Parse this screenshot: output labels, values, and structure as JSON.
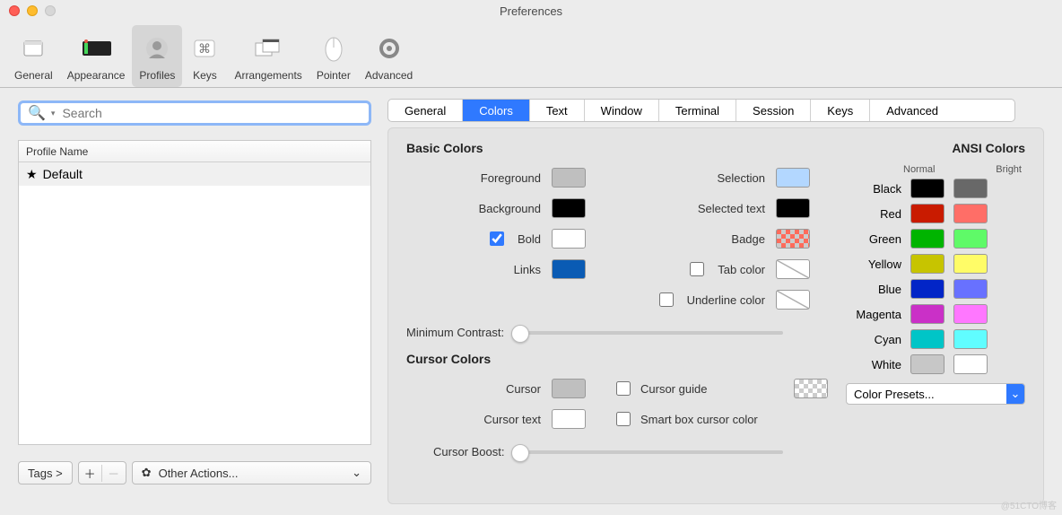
{
  "window": {
    "title": "Preferences"
  },
  "toolbar": {
    "items": [
      "General",
      "Appearance",
      "Profiles",
      "Keys",
      "Arrangements",
      "Pointer",
      "Advanced"
    ],
    "selected": "Profiles"
  },
  "search": {
    "placeholder": "Search"
  },
  "profiles": {
    "header": "Profile Name",
    "rows": [
      {
        "name": "Default",
        "star": true
      }
    ]
  },
  "bottom": {
    "tags": "Tags >",
    "actions": "Other Actions..."
  },
  "tabs": [
    "General",
    "Colors",
    "Text",
    "Window",
    "Terminal",
    "Session",
    "Keys",
    "Advanced"
  ],
  "active_tab": "Colors",
  "basic": {
    "title": "Basic Colors",
    "foreground": {
      "label": "Foreground",
      "color": "#bfbfbf"
    },
    "background": {
      "label": "Background",
      "color": "#000000"
    },
    "bold": {
      "label": "Bold",
      "color": "#ffffff",
      "checked": true
    },
    "links": {
      "label": "Links",
      "color": "#0a5bb4"
    },
    "selection": {
      "label": "Selection",
      "color": "#b3d7ff"
    },
    "selected_text": {
      "label": "Selected text",
      "color": "#000000"
    },
    "badge": {
      "label": "Badge",
      "color": "#ff6b5b",
      "checker": true
    },
    "tab_color": {
      "label": "Tab color",
      "checked": false,
      "diag": true
    },
    "underline_color": {
      "label": "Underline color",
      "checked": false,
      "diag": true
    },
    "min_contrast": "Minimum Contrast:"
  },
  "cursor": {
    "title": "Cursor Colors",
    "cursor": {
      "label": "Cursor",
      "color": "#bfbfbf"
    },
    "cursor_text": {
      "label": "Cursor text",
      "color": "#ffffff"
    },
    "cursor_guide": {
      "label": "Cursor guide",
      "checked": false,
      "checker": true
    },
    "smart_box": {
      "label": "Smart box cursor color",
      "checked": false
    },
    "cursor_boost": "Cursor Boost:"
  },
  "ansi": {
    "title": "ANSI Colors",
    "normal_label": "Normal",
    "bright_label": "Bright",
    "rows": [
      {
        "label": "Black",
        "normal": "#000000",
        "bright": "#686868"
      },
      {
        "label": "Red",
        "normal": "#c91b00",
        "bright": "#ff6e67"
      },
      {
        "label": "Green",
        "normal": "#00b400",
        "bright": "#5ffa68"
      },
      {
        "label": "Yellow",
        "normal": "#c7c400",
        "bright": "#fffc67"
      },
      {
        "label": "Blue",
        "normal": "#0225c7",
        "bright": "#6871ff"
      },
      {
        "label": "Magenta",
        "normal": "#ca30c7",
        "bright": "#ff77ff"
      },
      {
        "label": "Cyan",
        "normal": "#00c5c7",
        "bright": "#60fdff"
      },
      {
        "label": "White",
        "normal": "#c7c7c7",
        "bright": "#ffffff"
      }
    ],
    "preset": "Color Presets..."
  },
  "watermark": "@51CTO博客"
}
